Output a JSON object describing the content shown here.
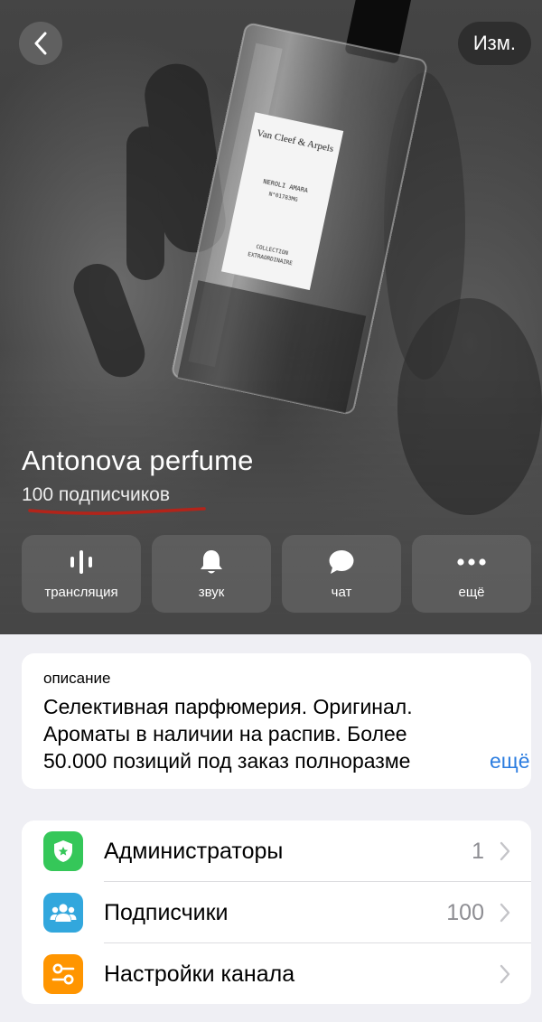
{
  "header": {
    "edit_label": "Изм."
  },
  "channel": {
    "title": "Antonova perfume",
    "subscribers_text": "100 подписчиков"
  },
  "photo": {
    "bottle_label_lines": [
      "Van Cleef & Arpels",
      "NEROLI AMARA",
      "N°01783MG",
      "COLLECTION",
      "EXTRAORDINAIRE"
    ]
  },
  "actions": [
    {
      "label": "трансляция",
      "icon": "broadcast-icon"
    },
    {
      "label": "звук",
      "icon": "bell-icon"
    },
    {
      "label": "чат",
      "icon": "chat-bubble-icon"
    },
    {
      "label": "ещё",
      "icon": "more-dots-icon"
    }
  ],
  "description": {
    "caption": "описание",
    "lines": [
      "Селективная парфюмерия. Оригинал.",
      "Ароматы в наличии на распив. Более",
      "50.000 позиций под заказ полноразме"
    ],
    "more_label": "ещё"
  },
  "list": [
    {
      "label": "Администраторы",
      "value": "1",
      "icon": "shield-icon",
      "color": "#35c759"
    },
    {
      "label": "Подписчики",
      "value": "100",
      "icon": "people-icon",
      "color": "#32a7dd"
    },
    {
      "label": "Настройки канала",
      "value": "",
      "icon": "settings-toggles-icon",
      "color": "#ff9500"
    }
  ],
  "colors": {
    "accent": "#2c7de0",
    "underline": "#b3241a",
    "background": "#efeff4"
  }
}
